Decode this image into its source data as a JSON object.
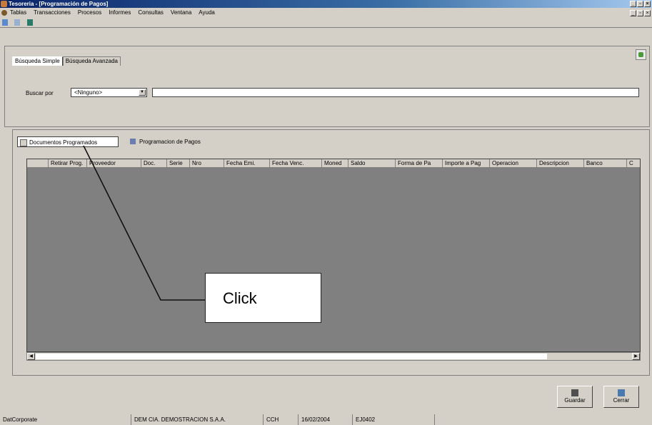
{
  "window": {
    "title": "Tesoreria - [Programación de Pagos]"
  },
  "menu": [
    {
      "label": "Tablas"
    },
    {
      "label": "Transacciones"
    },
    {
      "label": "Procesos"
    },
    {
      "label": "Informes"
    },
    {
      "label": "Consultas"
    },
    {
      "label": "Ventana"
    },
    {
      "label": "Ayuda"
    }
  ],
  "search_tabs": [
    {
      "label": "Búsqueda Simple"
    },
    {
      "label": "Búsqueda Avanzada"
    }
  ],
  "search": {
    "label": "Buscar por",
    "selected": "<Ninguno>",
    "value": ""
  },
  "view_tabs": [
    {
      "label": "Documentos Programados"
    },
    {
      "label": "Programacion de Pagos"
    }
  ],
  "grid": {
    "columns": [
      "Retirar Prog.",
      "Proveedor",
      "Doc.",
      "Serie",
      "Nro",
      "Fecha Emi.",
      "Fecha Venc.",
      "Moned",
      "Saldo",
      "Forma de Pa",
      "Importe a Pag",
      "Operacion",
      "Descripcion",
      "Banco",
      "C"
    ]
  },
  "callout": {
    "text": "Click"
  },
  "actions": {
    "save": "Guardar",
    "close": "Cerrar"
  },
  "status": {
    "app": "DatCorporate",
    "company": "DEM CIA. DEMOSTRACION S.A.A.",
    "code": "CCH",
    "date": "16/02/2004",
    "period": "EJ0402"
  }
}
